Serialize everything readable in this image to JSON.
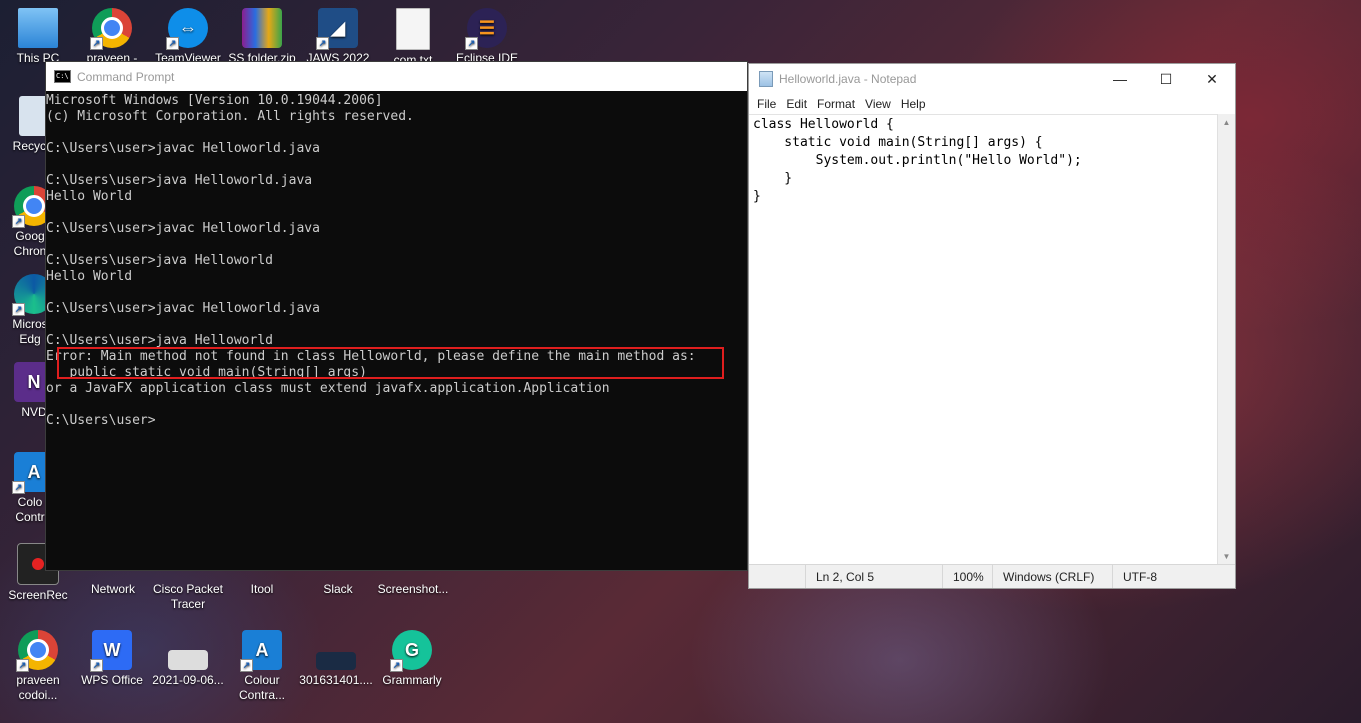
{
  "desktop": {
    "icons": [
      {
        "label": "This PC",
        "icon": "pc-icon"
      },
      {
        "label": "praveen -",
        "icon": "chrome-icon"
      },
      {
        "label": "TeamViewer",
        "icon": "teamviewer-icon"
      },
      {
        "label": "SS folder.zip",
        "icon": "zip-icon"
      },
      {
        "label": "JAWS 2022",
        "icon": "jaws-icon"
      },
      {
        "label": "com.txt",
        "icon": "text-file-icon"
      },
      {
        "label": "Eclipse IDE",
        "icon": "eclipse-icon"
      },
      {
        "label": "Recycle",
        "icon": "recycle-bin-icon"
      },
      {
        "label": "Goog Chron",
        "icon": "chrome-icon"
      },
      {
        "label": "Micros Edg",
        "icon": "edge-icon"
      },
      {
        "label": "NVD",
        "icon": "nvda-icon"
      },
      {
        "label": "Colo Contr",
        "icon": "colour-contrast-icon"
      },
      {
        "label": "ScreenRec",
        "icon": "screenrec-icon"
      },
      {
        "label": "Network",
        "icon": "network-icon"
      },
      {
        "label": "Cisco Packet Tracer",
        "icon": "cisco-icon"
      },
      {
        "label": "Itool",
        "icon": "itool-icon"
      },
      {
        "label": "Slack",
        "icon": "slack-icon"
      },
      {
        "label": "Screenshot...",
        "icon": "screenshot-icon"
      },
      {
        "label": "praveen codoi...",
        "icon": "chrome-icon"
      },
      {
        "label": "WPS Office",
        "icon": "wps-icon"
      },
      {
        "label": "2021-09-06...",
        "icon": "image-file-icon"
      },
      {
        "label": "Colour Contra...",
        "icon": "colour-contrast-icon"
      },
      {
        "label": "301631401....",
        "icon": "image-file-icon"
      },
      {
        "label": "Grammarly",
        "icon": "grammarly-icon"
      }
    ]
  },
  "cmd": {
    "title": "Command Prompt",
    "lines": [
      "Microsoft Windows [Version 10.0.19044.2006]",
      "(c) Microsoft Corporation. All rights reserved.",
      "",
      "C:\\Users\\user>javac Helloworld.java",
      "",
      "C:\\Users\\user>java Helloworld.java",
      "Hello World",
      "",
      "C:\\Users\\user>javac Helloworld.java",
      "",
      "C:\\Users\\user>java Helloworld",
      "Hello World",
      "",
      "C:\\Users\\user>javac Helloworld.java",
      "",
      "C:\\Users\\user>java Helloworld",
      "Error: Main method not found in class Helloworld, please define the main method as:",
      "   public static void main(String[] args)",
      "or a JavaFX application class must extend javafx.application.Application",
      "",
      "C:\\Users\\user>"
    ]
  },
  "notepad": {
    "title": "Helloworld.java - Notepad",
    "menu": [
      "File",
      "Edit",
      "Format",
      "View",
      "Help"
    ],
    "code": [
      "class Helloworld {",
      "    static void main(String[] args) {",
      "        System.out.println(\"Hello World\");",
      "    }",
      "}"
    ],
    "status": {
      "position": "Ln 2, Col 5",
      "zoom": "100%",
      "line_ending": "Windows (CRLF)",
      "encoding": "UTF-8"
    },
    "controls": {
      "minimize": "—",
      "maximize": "☐",
      "close": "✕"
    }
  }
}
